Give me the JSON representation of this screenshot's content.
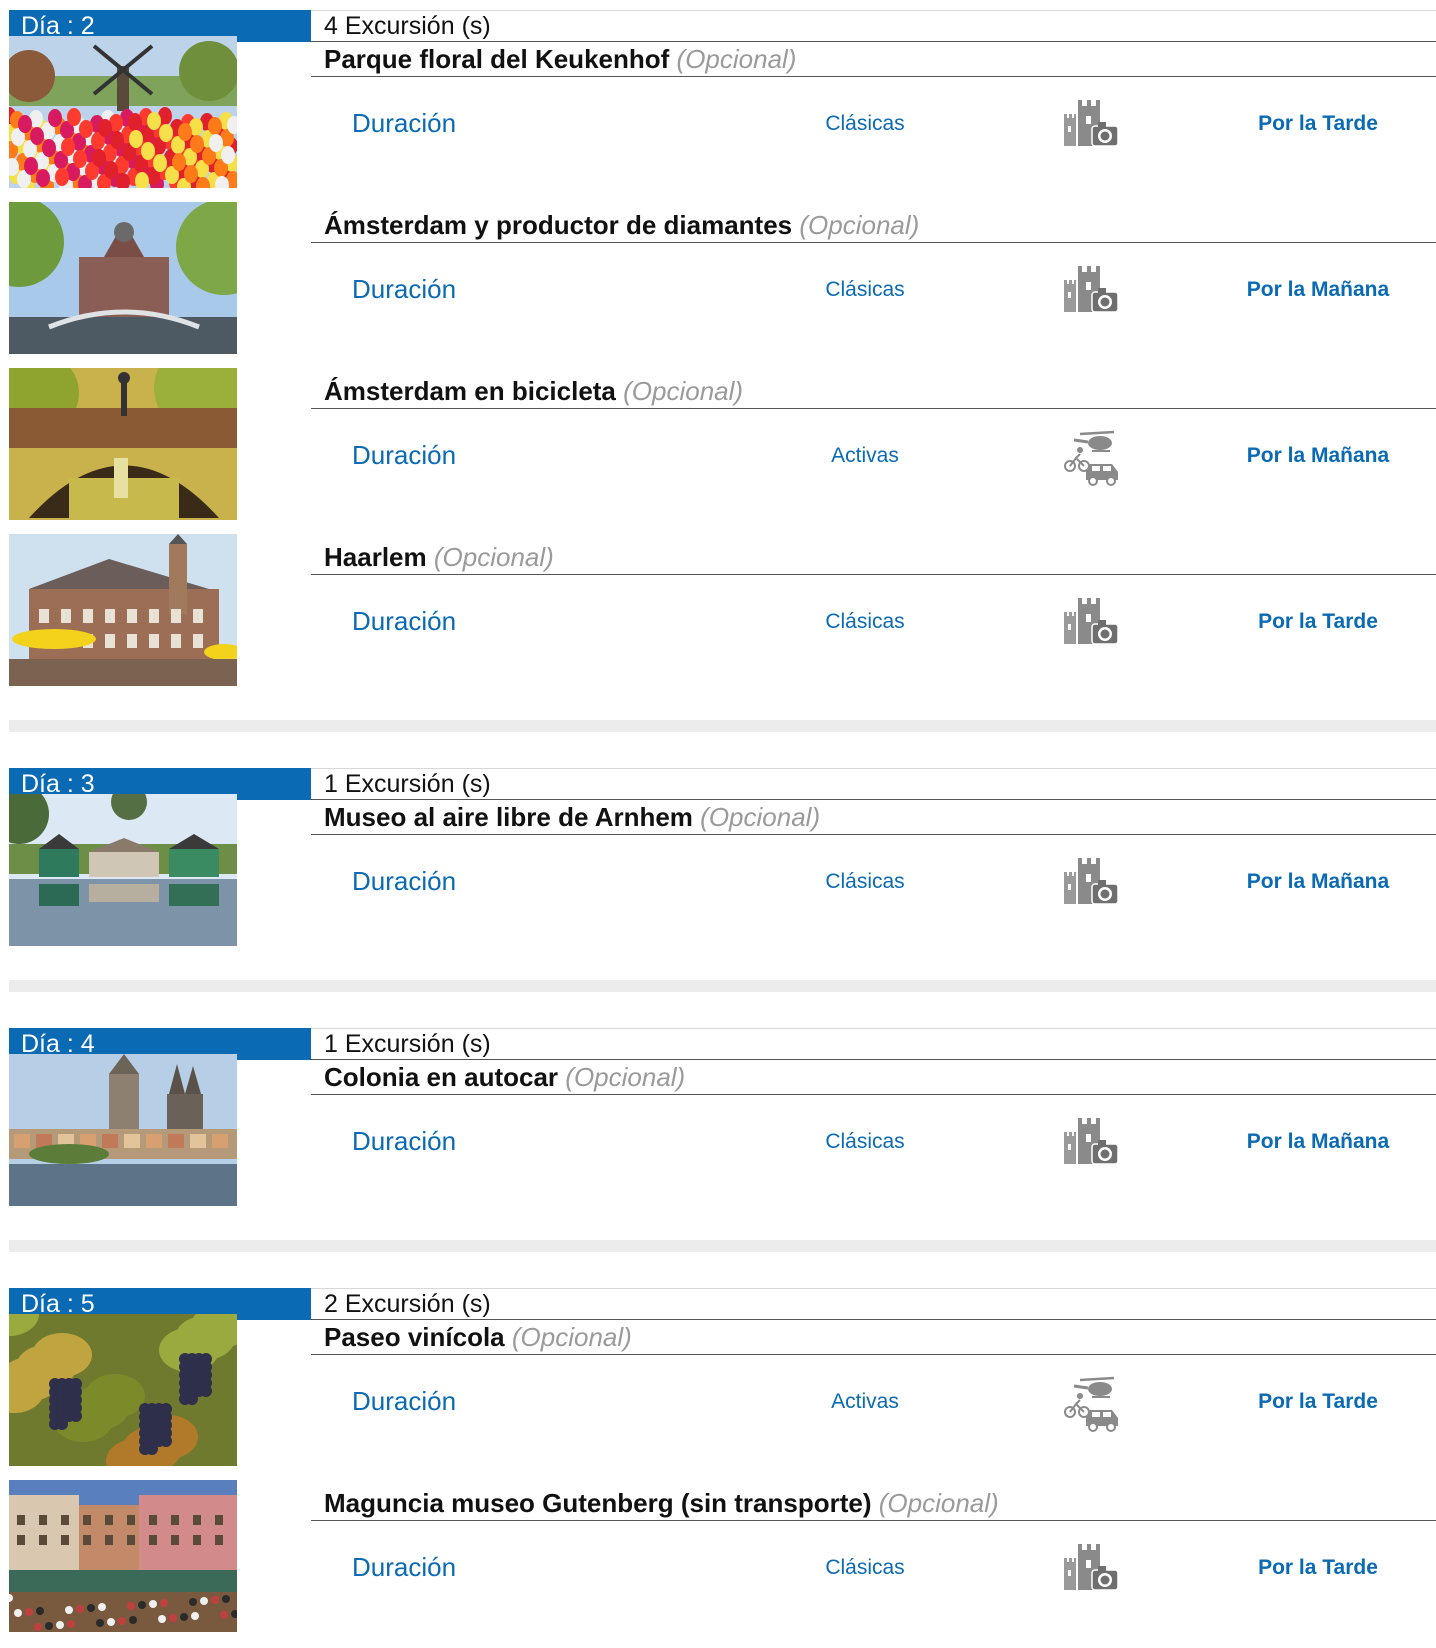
{
  "labels": {
    "day_prefix": "Día : ",
    "count_suffix": " Excursión (s)",
    "optional": "(Opcional)",
    "duration": "Duración"
  },
  "colors": {
    "accent": "#0a6ab3",
    "optional_grey": "#9a9a9a",
    "separator": "#ececec"
  },
  "days": [
    {
      "day": "2",
      "count": "4",
      "excursions": [
        {
          "name": "Parque floral del Keukenhof",
          "category": "Clásicas",
          "icon": "castle-camera-icon",
          "time": "Por la Tarde",
          "image": "tulips-windmill"
        },
        {
          "name": "Ámsterdam y productor de diamantes",
          "category": "Clásicas",
          "icon": "castle-camera-icon",
          "time": "Por la Mañana",
          "image": "canal-church"
        },
        {
          "name": "Ámsterdam en bicicleta",
          "category": "Activas",
          "icon": "helicopter-bike-car-icon",
          "time": "Por la Mañana",
          "image": "bridge-canal"
        },
        {
          "name": "Haarlem",
          "category": "Clásicas",
          "icon": "castle-camera-icon",
          "time": "Por la Tarde",
          "image": "town-square"
        }
      ]
    },
    {
      "day": "3",
      "count": "1",
      "excursions": [
        {
          "name": "Museo al aire libre de Arnhem",
          "category": "Clásicas",
          "icon": "castle-camera-icon",
          "time": "Por la Mañana",
          "image": "lake-houses"
        }
      ]
    },
    {
      "day": "4",
      "count": "1",
      "excursions": [
        {
          "name": "Colonia en autocar",
          "category": "Clásicas",
          "icon": "castle-camera-icon",
          "time": "Por la Mañana",
          "image": "cathedral-river"
        }
      ]
    },
    {
      "day": "5",
      "count": "2",
      "excursions": [
        {
          "name": "Paseo vinícola",
          "category": "Activas",
          "icon": "helicopter-bike-car-icon",
          "time": "Por la Tarde",
          "image": "grapes"
        },
        {
          "name": "Maguncia museo Gutenberg (sin transporte)",
          "category": "Clásicas",
          "icon": "castle-camera-icon",
          "time": "Por la Tarde",
          "image": "market-square"
        }
      ]
    }
  ]
}
